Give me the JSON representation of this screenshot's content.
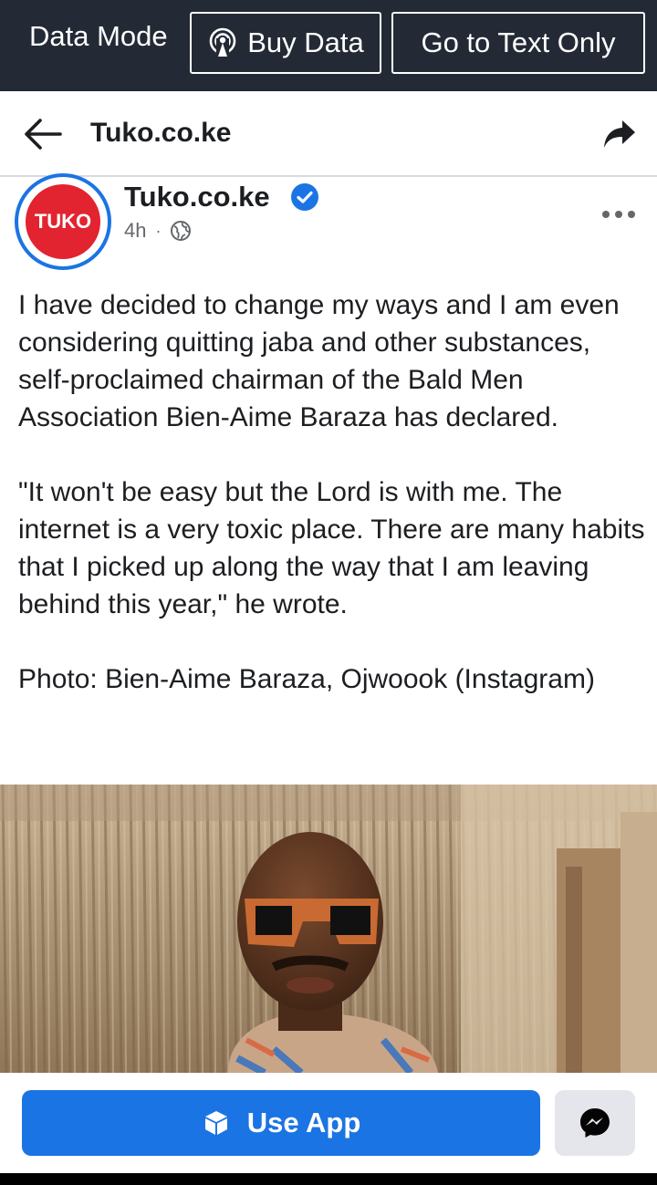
{
  "topbar": {
    "mode_label": "Data Mode",
    "buy_data_label": "Buy Data",
    "text_only_label": "Go to Text Only"
  },
  "header": {
    "title": "Tuko.co.ke"
  },
  "post": {
    "avatar_text": "TUKO",
    "author": "Tuko.co.ke",
    "time": "4h",
    "separator": "·",
    "paragraphs": [
      "I have decided to change my ways and I am even considering quitting jaba and other substances, self-proclaimed chairman of the Bald Men Association Bien-Aime Baraza has declared.",
      "\"It won't be easy but the Lord is with me. The internet is a very toxic place. There are many habits that I picked up along the way that I am leaving behind this year,\" he wrote.",
      "Photo: Bien-Aime Baraza, Ojwoook (Instagram)"
    ]
  },
  "bottom": {
    "use_app_label": "Use App"
  },
  "icons": {
    "back": "arrow-left-icon",
    "share": "share-icon",
    "verified": "verified-badge-icon",
    "audience": "globe-icon",
    "more": "more-options-icon",
    "buy_data": "podcast-signal-icon",
    "use_app": "cube-icon",
    "messenger": "messenger-icon"
  },
  "colors": {
    "topbar_bg": "#242a35",
    "brand_blue": "#1b74e4",
    "tuko_red": "#e22330",
    "meta_gray": "#65676b"
  }
}
